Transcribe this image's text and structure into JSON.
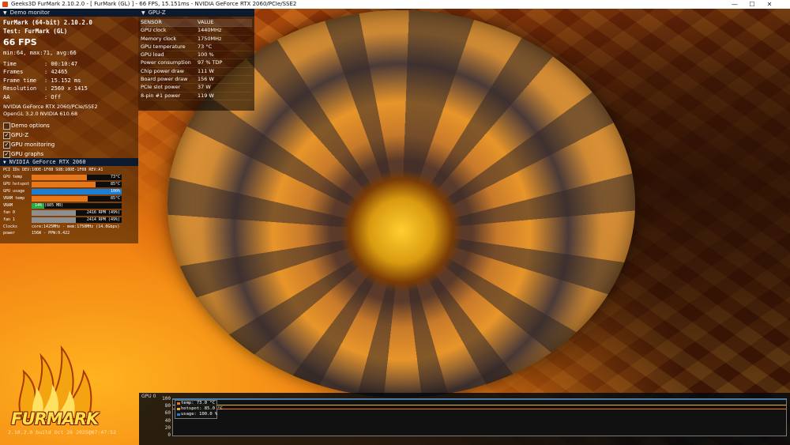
{
  "window": {
    "title": "Geeks3D FurMark 2.10.2.0 - [ FurMark (GL) ] - 66 FPS, 15.151ms - NVIDIA GeForce RTX 2060/PCIe/SSE2",
    "minimize": "—",
    "maximize": "☐",
    "close": "✕"
  },
  "demo_monitor": {
    "header": "Demo monitor",
    "app_line": "FurMark (64-bit) 2.10.2.0",
    "test_line": "Test: FurMark (GL)",
    "fps": "66 FPS",
    "fps_stats": "min:64, max:71, avg:66",
    "stats": [
      {
        "k": "Time",
        "v": ": 00:10:47"
      },
      {
        "k": "Frames",
        "v": ": 42465"
      },
      {
        "k": "Frame time",
        "v": ": 15.152 ms"
      },
      {
        "k": "Resolution",
        "v": ": 2560 x 1415"
      },
      {
        "k": "AA",
        "v": ": Off"
      }
    ],
    "gpu_name": "NVIDIA GeForce RTX 2060/PCIe/SSE2",
    "gl_version": "OpenGL 3.2.0 NVIDIA 610.68",
    "options": [
      {
        "label": "Demo options",
        "checked": false
      },
      {
        "label": "GPU-Z",
        "checked": true
      },
      {
        "label": "GPU monitoring",
        "checked": true
      },
      {
        "label": "GPU graphs",
        "checked": true
      }
    ]
  },
  "gpuz": {
    "header": "GPU-Z",
    "col_sensor": "SENSOR",
    "col_value": "VALUE",
    "rows": [
      {
        "sensor": "GPU clock",
        "value": "1440MHz"
      },
      {
        "sensor": "Memory clock",
        "value": "1750MHz"
      },
      {
        "sensor": "GPU temperature",
        "value": "73 °C"
      },
      {
        "sensor": "GPU load",
        "value": "100 %"
      },
      {
        "sensor": "Power consumption",
        "value": "97 % TDP"
      },
      {
        "sensor": "Chip power draw",
        "value": "111 W"
      },
      {
        "sensor": "Board power draw",
        "value": "156 W"
      },
      {
        "sensor": "PCIe slot power",
        "value": "37 W"
      },
      {
        "sensor": "8-pin #1 power",
        "value": "119 W"
      }
    ]
  },
  "gpu": {
    "header": "NVIDIA GeForce RTX 2060",
    "pci": "PCI IDs  DEV:10DE-1F08 SUB:10DE-1F08 REV:A1",
    "bars": [
      {
        "label": "GPU temp",
        "text": "73°C",
        "fraction": 0.61,
        "color": "#e8771a",
        "align": "right"
      },
      {
        "label": "GPU hotspot",
        "text": "85°C",
        "fraction": 0.71,
        "color": "#e8771a",
        "align": "right"
      },
      {
        "label": "GPU usage",
        "text": "100%",
        "fraction": 1.0,
        "color": "#1c7fd6",
        "align": "right"
      },
      {
        "label": "VRAM temp",
        "text": "85°C",
        "fraction": 0.62,
        "color": "#e8771a",
        "align": "right"
      },
      {
        "label": "VRAM",
        "text": "14% (885 MB)",
        "fraction": 0.14,
        "color": "#2aa94a",
        "align": "left"
      },
      {
        "label": "fan 0",
        "text": "2416 RPM (49%)",
        "fraction": 0.49,
        "color": "#8f8f8f",
        "align": "right"
      },
      {
        "label": "fan 1",
        "text": "2414 RPM (49%)",
        "fraction": 0.49,
        "color": "#8f8f8f",
        "align": "right"
      }
    ],
    "clocks_label": "Clocks",
    "clocks_value": "core:1425MHz - mem:1750MHz (14.0Gbps)",
    "power_label": "power",
    "power_value": "156W - PPW:0.422"
  },
  "logo": {
    "text": "FURMARK",
    "build": "2.10.2.0 build Oct 26 2025@07:47:52"
  },
  "graph": {
    "title": "GPU 0",
    "y_ticks": [
      "100",
      "80",
      "60",
      "40",
      "20",
      "0"
    ],
    "legend": [
      {
        "label": "temp: 73.0 °C",
        "color": "#e8771a"
      },
      {
        "label": "hotspot: 85.0 °C",
        "color": "#e8b040"
      },
      {
        "label": "usage: 100.0 %",
        "color": "#1c7fd6"
      }
    ],
    "series_values": [
      73,
      85,
      100
    ]
  }
}
